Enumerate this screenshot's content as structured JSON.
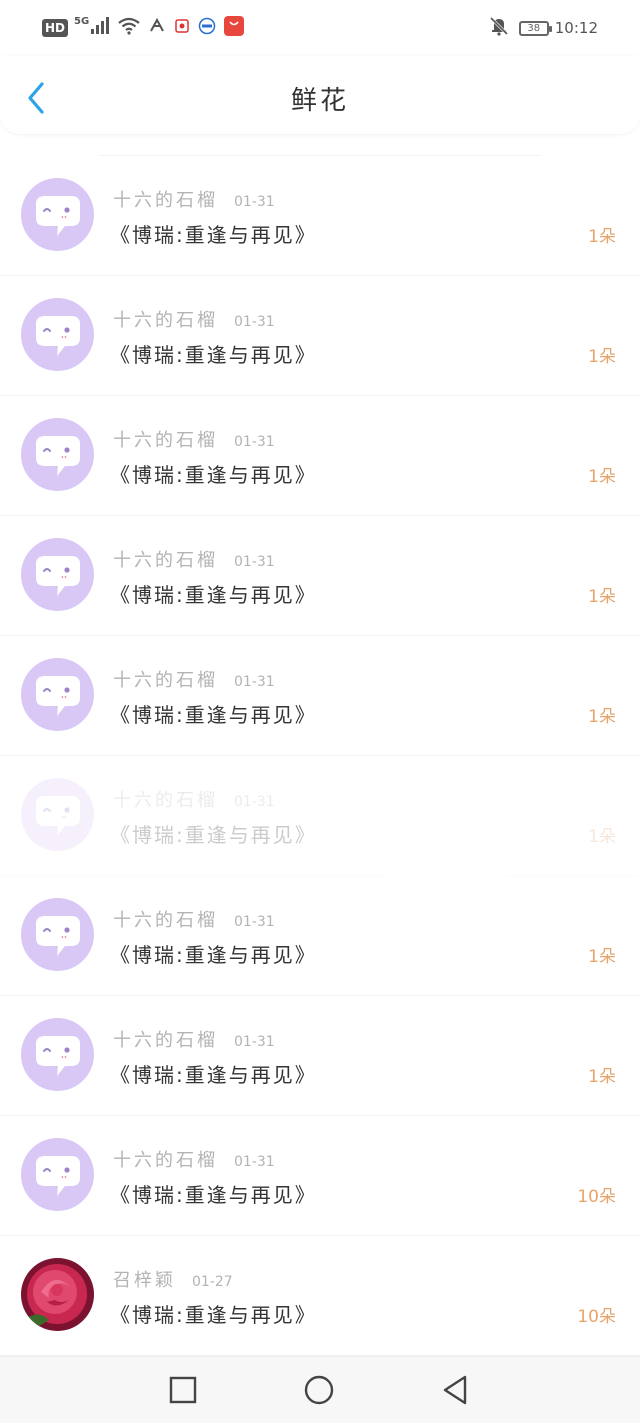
{
  "status_bar": {
    "network_badge": "HD",
    "network_type": "5G",
    "battery_level": "38",
    "time": "10:12"
  },
  "header": {
    "title": "鲜花"
  },
  "gift_list": [
    {
      "name": "十六的石榴",
      "date": "01-31",
      "book": "《博瑞:重逢与再见》",
      "count": "1朵",
      "avatar": "chat-bubble-avatar"
    },
    {
      "name": "十六的石榴",
      "date": "01-31",
      "book": "《博瑞:重逢与再见》",
      "count": "1朵",
      "avatar": "chat-bubble-avatar"
    },
    {
      "name": "十六的石榴",
      "date": "01-31",
      "book": "《博瑞:重逢与再见》",
      "count": "1朵",
      "avatar": "chat-bubble-avatar"
    },
    {
      "name": "十六的石榴",
      "date": "01-31",
      "book": "《博瑞:重逢与再见》",
      "count": "1朵",
      "avatar": "chat-bubble-avatar"
    },
    {
      "name": "十六的石榴",
      "date": "01-31",
      "book": "《博瑞:重逢与再见》",
      "count": "1朵",
      "avatar": "chat-bubble-avatar"
    },
    {
      "name": "十六的石榴",
      "date": "01-31",
      "book": "《博瑞:重逢与再见》",
      "count": "1朵",
      "avatar": "chat-bubble-avatar"
    },
    {
      "name": "十六的石榴",
      "date": "01-31",
      "book": "《博瑞:重逢与再见》",
      "count": "1朵",
      "avatar": "chat-bubble-avatar"
    },
    {
      "name": "十六的石榴",
      "date": "01-31",
      "book": "《博瑞:重逢与再见》",
      "count": "1朵",
      "avatar": "chat-bubble-avatar"
    },
    {
      "name": "十六的石榴",
      "date": "01-31",
      "book": "《博瑞:重逢与再见》",
      "count": "10朵",
      "avatar": "chat-bubble-avatar"
    },
    {
      "name": "召梓颖",
      "date": "01-27",
      "book": "《博瑞:重逢与再见》",
      "count": "10朵",
      "avatar": "rose-photo-avatar"
    }
  ],
  "colors": {
    "accent_blue": "#2aa3e8",
    "avatar_lavender": "#d9c7f6",
    "count_orange": "#e7a46b",
    "name_gray": "#b3b3b3"
  },
  "icons": {
    "back": "chevron-left-icon",
    "nav_recent": "square-icon",
    "nav_home": "circle-icon",
    "nav_back": "triangle-back-icon"
  }
}
